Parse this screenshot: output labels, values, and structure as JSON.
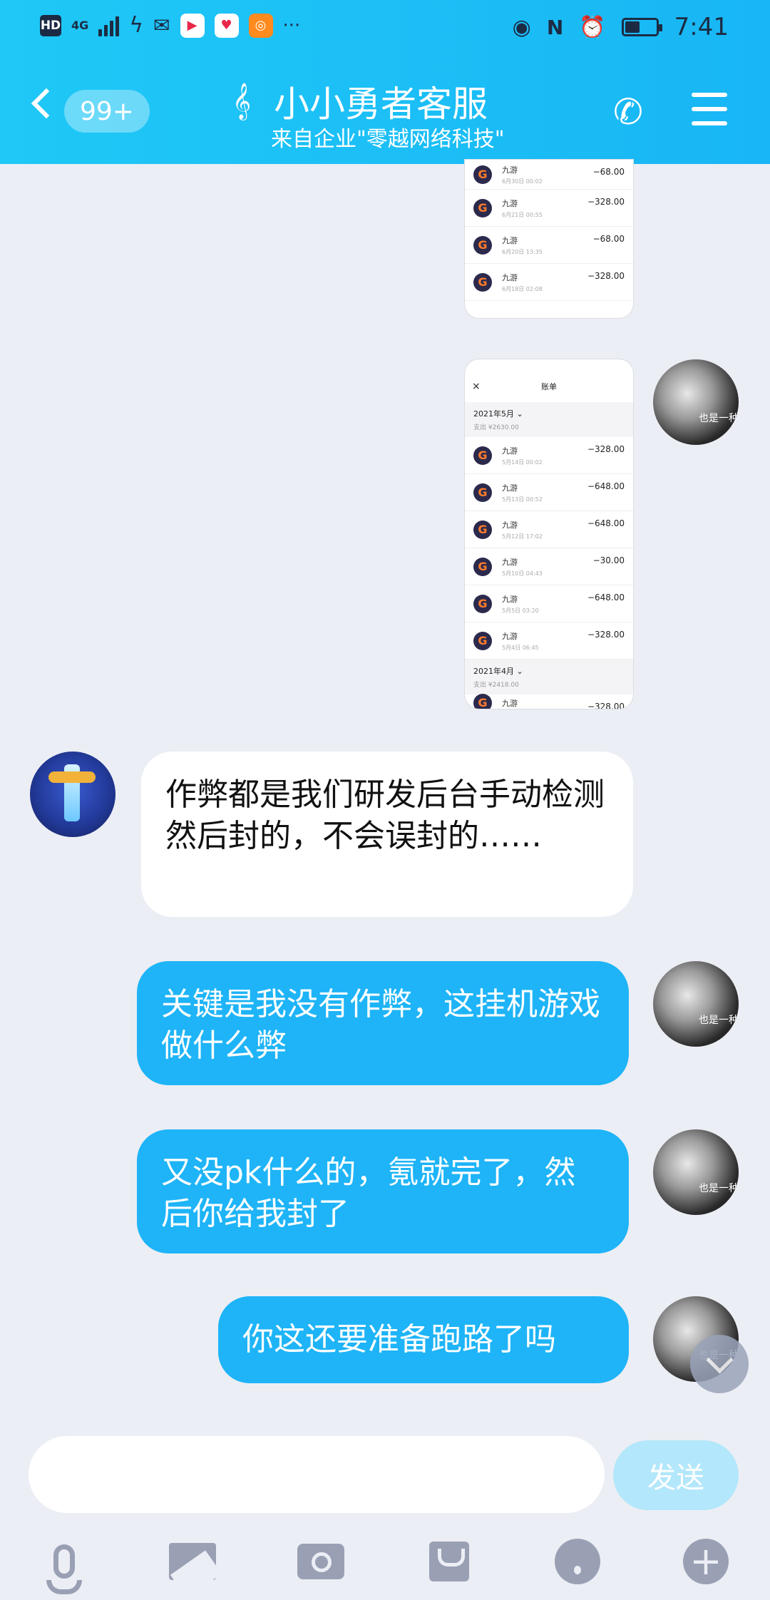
{
  "status_bar": {
    "hd": "HD",
    "network": "4G",
    "time": "7:41",
    "more": "···"
  },
  "header": {
    "back_badge": "99+",
    "title": "小小勇者客服",
    "subtitle": "来自企业\"零越网络科技\""
  },
  "image_message_1": {
    "rows": [
      {
        "name": "九游",
        "date": "6月30日 00:02",
        "amount": "−68.00"
      },
      {
        "name": "九游",
        "date": "6月21日 00:55",
        "amount": "−328.00"
      },
      {
        "name": "九游",
        "date": "6月20日 13:35",
        "amount": "−68.00"
      },
      {
        "name": "九游",
        "date": "6月18日 02:08",
        "amount": "−328.00"
      }
    ]
  },
  "image_message_2": {
    "title": "账单",
    "month_1": {
      "label": "2021年5月 ⌄",
      "sub": "支出 ¥2630.00"
    },
    "rows": [
      {
        "name": "九游",
        "date": "5月14日 00:02",
        "amount": "−328.00"
      },
      {
        "name": "九游",
        "date": "5月13日 00:52",
        "amount": "−648.00"
      },
      {
        "name": "九游",
        "date": "5月12日 17:02",
        "amount": "−648.00"
      },
      {
        "name": "九游",
        "date": "5月10日 04:43",
        "amount": "−30.00"
      },
      {
        "name": "九游",
        "date": "5月5日 03:20",
        "amount": "−648.00"
      },
      {
        "name": "九游",
        "date": "5月4日 06:45",
        "amount": "−328.00"
      }
    ],
    "month_2": {
      "label": "2021年4月 ⌄",
      "sub": "支出 ¥2418.00"
    },
    "last_row": {
      "name": "九游",
      "amount": "−328.00"
    }
  },
  "messages": [
    {
      "from": "cs",
      "text": "作弊都是我们研发后台手动检测然后封的，不会误封的……"
    },
    {
      "from": "me",
      "text": "关键是我没有作弊，这挂机游戏做什么弊"
    },
    {
      "from": "me",
      "text": "又没pk什么的，氪就完了，然后你给我封了"
    },
    {
      "from": "me",
      "text": "你这还要准备跑路了吗"
    }
  ],
  "input": {
    "placeholder": "",
    "send_label": "发送"
  },
  "toolbar": {
    "items": [
      "voice-icon",
      "image-icon",
      "camera-icon",
      "red-packet-icon",
      "emoji-icon",
      "plus-icon"
    ]
  },
  "colors": {
    "header": "#1fc8f6",
    "outgoing_bubble": "#1eb4f7",
    "incoming_bubble": "#ffffff",
    "background": "#eceef5"
  }
}
